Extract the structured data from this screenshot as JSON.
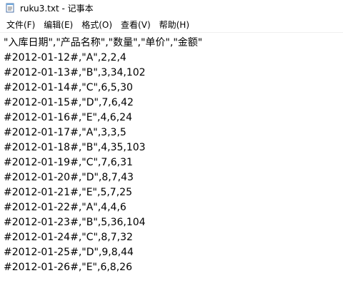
{
  "window": {
    "title": "ruku3.txt - 记事本",
    "icon": "notepad-icon"
  },
  "menu": {
    "items": [
      {
        "label": "文件(F)"
      },
      {
        "label": "编辑(E)"
      },
      {
        "label": "格式(O)"
      },
      {
        "label": "查看(V)"
      },
      {
        "label": "帮助(H)"
      }
    ]
  },
  "editor": {
    "lines": [
      "\"入库日期\",\"产品名称\",\"数量\",\"单价\",\"金额\"",
      "#2012-01-12#,\"A\",2,2,4",
      "#2012-01-13#,\"B\",3,34,102",
      "#2012-01-14#,\"C\",6,5,30",
      "#2012-01-15#,\"D\",7,6,42",
      "#2012-01-16#,\"E\",4,6,24",
      "#2012-01-17#,\"A\",3,3,5",
      "#2012-01-18#,\"B\",4,35,103",
      "#2012-01-19#,\"C\",7,6,31",
      "#2012-01-20#,\"D\",8,7,43",
      "#2012-01-21#,\"E\",5,7,25",
      "#2012-01-22#,\"A\",4,4,6",
      "#2012-01-23#,\"B\",5,36,104",
      "#2012-01-24#,\"C\",8,7,32",
      "#2012-01-25#,\"D\",9,8,44",
      "#2012-01-26#,\"E\",6,8,26"
    ]
  }
}
